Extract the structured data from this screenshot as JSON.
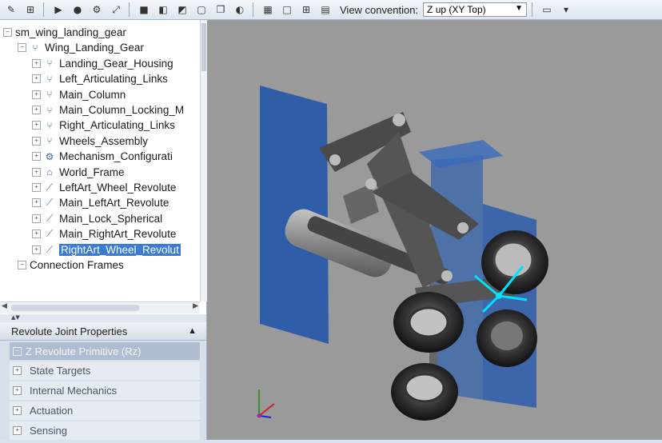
{
  "toolbar": {
    "view_convention_label": "View convention:",
    "view_convention_value": "Z up (XY Top)"
  },
  "tree": {
    "items": [
      {
        "label": "sm_wing_landing_gear",
        "indent": 0
      },
      {
        "label": "Wing_Landing_Gear",
        "indent": 1
      },
      {
        "label": "Landing_Gear_Housing",
        "indent": 2
      },
      {
        "label": "Left_Articulating_Links",
        "indent": 2
      },
      {
        "label": "Main_Column",
        "indent": 2
      },
      {
        "label": "Main_Column_Locking_M",
        "indent": 2
      },
      {
        "label": "Right_Articulating_Links",
        "indent": 2
      },
      {
        "label": "Wheels_Assembly",
        "indent": 2
      },
      {
        "label": "Mechanism_Configurati",
        "indent": 2
      },
      {
        "label": "World_Frame",
        "indent": 2
      },
      {
        "label": "LeftArt_Wheel_Revolute",
        "indent": 2
      },
      {
        "label": "Main_LeftArt_Revolute",
        "indent": 2
      },
      {
        "label": "Main_Lock_Spherical",
        "indent": 2
      },
      {
        "label": "Main_RightArt_Revolute",
        "indent": 2
      },
      {
        "label": "RightArt_Wheel_Revolut",
        "indent": 2,
        "selected": true
      },
      {
        "label": "Connection Frames",
        "indent": 1
      }
    ]
  },
  "props": {
    "title": "Revolute Joint Properties",
    "group": "Z Revolute Primitive (Rz)",
    "items": [
      "State Targets",
      "Internal Mechanics",
      "Actuation",
      "Sensing"
    ]
  }
}
